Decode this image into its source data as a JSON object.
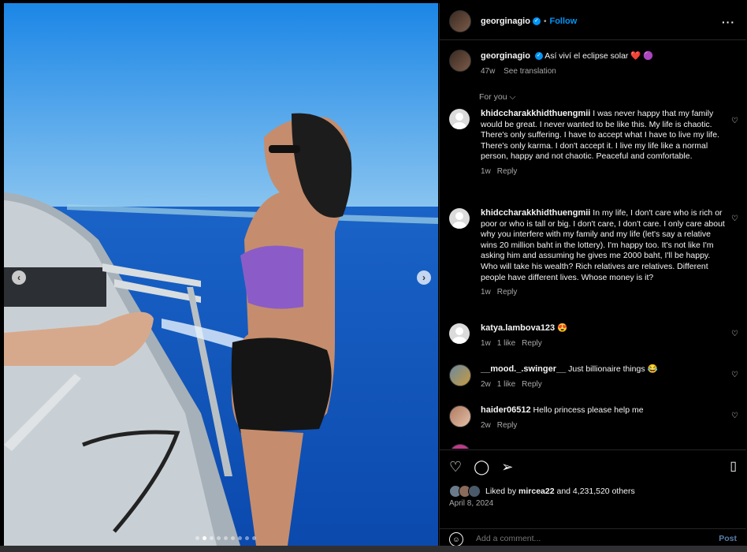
{
  "header": {
    "username": "georginagio",
    "follow": "Follow"
  },
  "caption": {
    "username": "georginagio",
    "text": "Así viví el eclipse solar",
    "emoji": "❤️ 🟣",
    "age": "47w",
    "translation": "See translation"
  },
  "sort": {
    "label": "For you"
  },
  "comments": [
    {
      "username": "khidccharakkhidthuengmii",
      "text": "I was never happy that my family would be great. I never wanted to be like this. My life is chaotic. There's only suffering. I have to accept what I have to live my life. There's only karma. I don't accept it. I live my life like a normal person, happy and not chaotic. Peaceful and comfortable.",
      "age": "1w",
      "likes": "",
      "reply": "Reply"
    },
    {
      "username": "khidccharakkhidthuengmii",
      "text": "In my life, I don't care who is rich or poor or who is tall or big. I don't care, I don't care. I only care about why you interfere with my family and my life (let's say a relative wins 20 million baht in the lottery). I'm happy too. It's not like I'm asking him and assuming he gives me 2000 baht, I'll be happy. Who will take his wealth? Rich relatives are relatives. Different people have different lives. Whose money is it?",
      "age": "1w",
      "likes": "",
      "reply": "Reply"
    },
    {
      "username": "katya.lambova123",
      "text": "😍",
      "age": "1w",
      "likes": "1 like",
      "reply": "Reply"
    },
    {
      "username": "__mood._.swinger__",
      "text": "Just billionaire things 😂",
      "age": "2w",
      "likes": "1 like",
      "reply": "Reply"
    },
    {
      "username": "haider06512",
      "text": "Hello princess please help me",
      "age": "2w",
      "likes": "",
      "reply": "Reply"
    }
  ],
  "likes": {
    "prefix": "Liked by",
    "user": "mircea22",
    "rest": "and 4,231,520 others"
  },
  "date": "April 8, 2024",
  "add_comment": {
    "placeholder": "Add a comment...",
    "post": "Post"
  },
  "icons": [
    "heart-icon",
    "comment-icon",
    "share-icon",
    "bookmark-icon",
    "emoji-icon",
    "more-icon",
    "chevron-left-icon",
    "chevron-right-icon"
  ],
  "colors": {
    "accent": "#0095f6",
    "background": "#000000",
    "muted": "#a8a8a8"
  }
}
